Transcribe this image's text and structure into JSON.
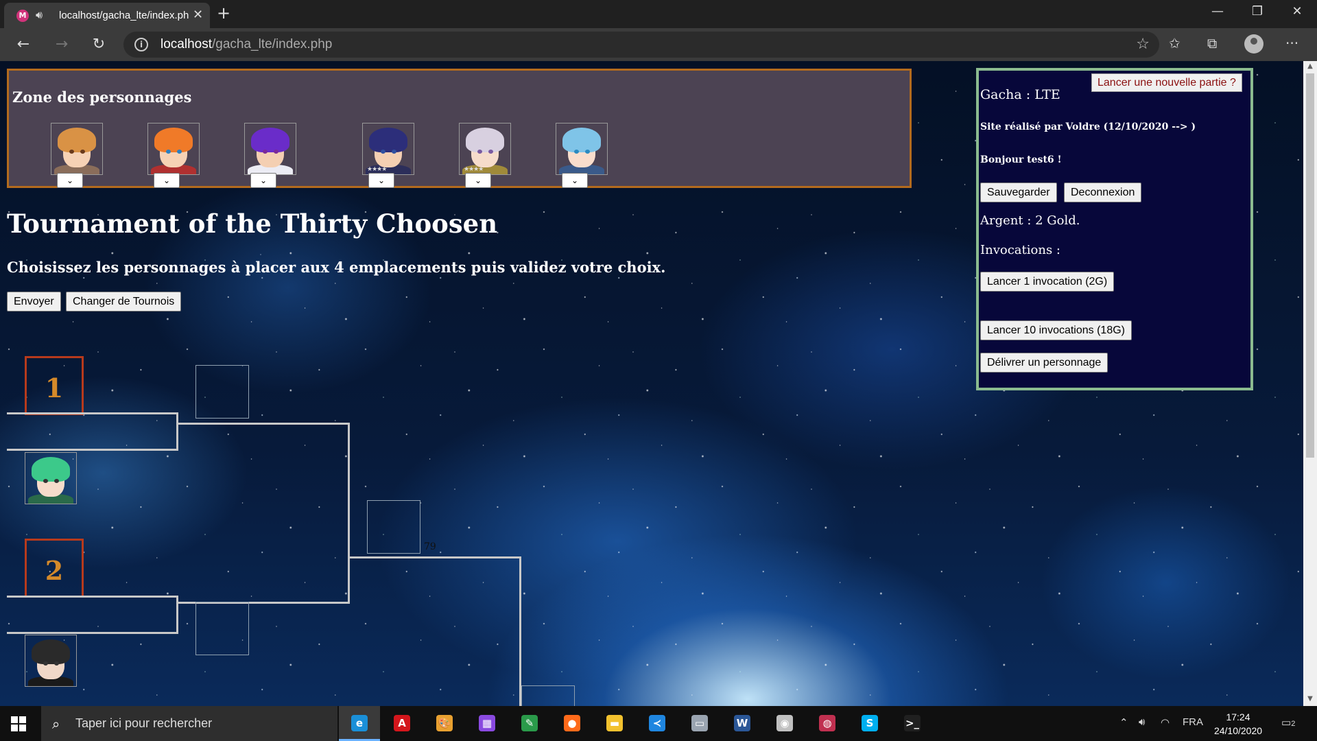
{
  "browser": {
    "tab_title": "localhost/gacha_lte/index.php",
    "tab_favicon": "M",
    "url_host": "localhost",
    "url_path": "/gacha_lte/index.php",
    "icons": [
      "speaker-icon",
      "close-icon",
      "plus-icon",
      "back-icon",
      "forward-icon",
      "refresh-icon",
      "info-icon",
      "star-icon",
      "favorites-icon",
      "collections-icon",
      "profile-icon",
      "more-icon"
    ]
  },
  "char_zone": {
    "title": "Zone des personnages",
    "characters": [
      {
        "name": "char-1",
        "hair": "#d99245",
        "skin": "#f6d2b5",
        "clothes": "#8a6d5a",
        "eye": "#6a3a1a",
        "stars": ""
      },
      {
        "name": "char-2",
        "hair": "#f07a28",
        "skin": "#f6d2b5",
        "clothes": "#b03030",
        "eye": "#2a7fc0",
        "stars": ""
      },
      {
        "name": "char-3",
        "hair": "#6a2cc9",
        "skin": "#f4cfb2",
        "clothes": "#ececf4",
        "eye": "#7a2a9a",
        "stars": ""
      },
      {
        "name": "char-4",
        "hair": "#2c2e7a",
        "skin": "#f4cfb2",
        "clothes": "#2c2e5a",
        "eye": "#3050a0",
        "stars": "★★★★"
      },
      {
        "name": "char-5",
        "hair": "#d8d0e0",
        "skin": "#f6dccb",
        "clothes": "#a08a3a",
        "eye": "#7a5aa0",
        "stars": "★★★★"
      },
      {
        "name": "char-6",
        "hair": "#7fc4e8",
        "skin": "#f8ddcc",
        "clothes": "#3a5a8a",
        "eye": "#2a8ac0",
        "stars": ""
      }
    ]
  },
  "tournament": {
    "title": "Tournament of the Thirty Choosen",
    "instructions": "Choisissez les personnages à placer aux 4 emplacements puis validez votre choix.",
    "send_label": "Envoyer",
    "change_label": "Changer de Tournois",
    "seeds": [
      "1",
      "2"
    ],
    "score": "79",
    "fighters": [
      {
        "hair": "#3cc98a",
        "skin": "#f6dccb",
        "clothes": "#2a6a4a"
      },
      {
        "hair": "#2a2a2a",
        "skin": "#f0d8c8",
        "clothes": "#1a1a1a"
      }
    ]
  },
  "side_panel": {
    "new_game_label": "Lancer une nouvelle partie ?",
    "site_name": "Gacha : LTE",
    "credits": "Site réalisé par Voldre (12/10/2020 --> )",
    "greeting": "Bonjour test6 !",
    "save_label": "Sauvegarder",
    "logout_label": "Deconnexion",
    "money": "Argent : 2 Gold.",
    "invocations_label": "Invocations :",
    "invoke_one_label": "Lancer 1 invocation (2G)",
    "invoke_ten_label": "Lancer 10 invocations (18G)",
    "deliver_label": "Délivrer un personnage"
  },
  "taskbar": {
    "search_placeholder": "Taper ici pour rechercher",
    "apps": [
      {
        "name": "edge-icon",
        "color": "#1a8fd8",
        "glyph": "e",
        "active": true
      },
      {
        "name": "acrobat-icon",
        "color": "#d4161c",
        "glyph": "A",
        "active": false
      },
      {
        "name": "paint-icon",
        "color": "#e8a030",
        "glyph": "🎨",
        "active": false
      },
      {
        "name": "colors-icon",
        "color": "#8a4ae0",
        "glyph": "▦",
        "active": false
      },
      {
        "name": "image-editor-icon",
        "color": "#2a9a4a",
        "glyph": "✎",
        "active": false
      },
      {
        "name": "firefox-icon",
        "color": "#ff6a1a",
        "glyph": "●",
        "active": false
      },
      {
        "name": "file-explorer-icon",
        "color": "#f2c12e",
        "glyph": "▬",
        "active": false
      },
      {
        "name": "vscode-icon",
        "color": "#1f86e0",
        "glyph": "≺",
        "active": false
      },
      {
        "name": "network-icon",
        "color": "#9aa4b0",
        "glyph": "▭",
        "active": false
      },
      {
        "name": "word-icon",
        "color": "#2b5797",
        "glyph": "W",
        "active": false
      },
      {
        "name": "disc-icon",
        "color": "#c0c0c0",
        "glyph": "◉",
        "active": false
      },
      {
        "name": "recorder-icon",
        "color": "#c03050",
        "glyph": "◍",
        "active": false
      },
      {
        "name": "skype-icon",
        "color": "#00aff0",
        "glyph": "S",
        "active": false
      },
      {
        "name": "terminal-icon",
        "color": "#202020",
        "glyph": ">_",
        "active": false
      }
    ],
    "language": "FRA",
    "time": "17:24",
    "date": "24/10/2020",
    "notifications": "2"
  }
}
